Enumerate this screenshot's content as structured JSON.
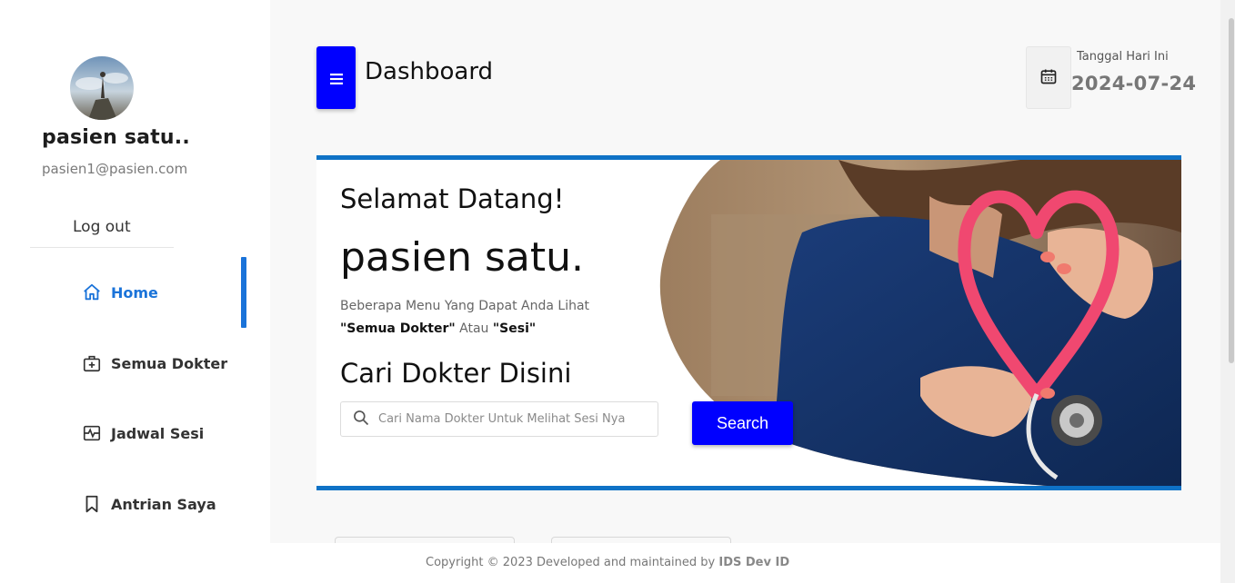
{
  "sidebar": {
    "profile_name": "pasien satu..",
    "profile_email": "pasien1@pasien.com",
    "logout_label": "Log out",
    "items": [
      {
        "label": "Home",
        "icon": "home-icon",
        "active": true
      },
      {
        "label": "Semua Dokter",
        "icon": "medical-kit-icon",
        "active": false
      },
      {
        "label": "Jadwal Sesi",
        "icon": "schedule-icon",
        "active": false
      },
      {
        "label": "Antrian Saya",
        "icon": "bookmark-icon",
        "active": false
      }
    ]
  },
  "header": {
    "menu_icon": "menu-icon",
    "title": "Dashboard",
    "date_label": "Tanggal Hari Ini",
    "date_value": "2024-07-24",
    "calendar_icon": "calendar-icon"
  },
  "banner": {
    "welcome": "Selamat Datang!",
    "patient_name": "pasien satu.",
    "hint_line1": "Beberapa Menu Yang Dapat Anda Lihat",
    "hint_opt1": "\"Semua Dokter\"",
    "hint_or": " Atau ",
    "hint_opt2": "\"Sesi\"",
    "search_title": "Cari Dokter Disini",
    "search_placeholder": "Cari Nama Dokter Untuk Melihat Sesi Nya",
    "search_button": "Search"
  },
  "footer": {
    "copyright": "Copyright © 2023 Developed and maintained by ",
    "brand": "IDS Dev ID"
  },
  "colors": {
    "accent": "#1a73d9",
    "button_blue": "#0000ff",
    "banner_border": "#0f72c6"
  }
}
